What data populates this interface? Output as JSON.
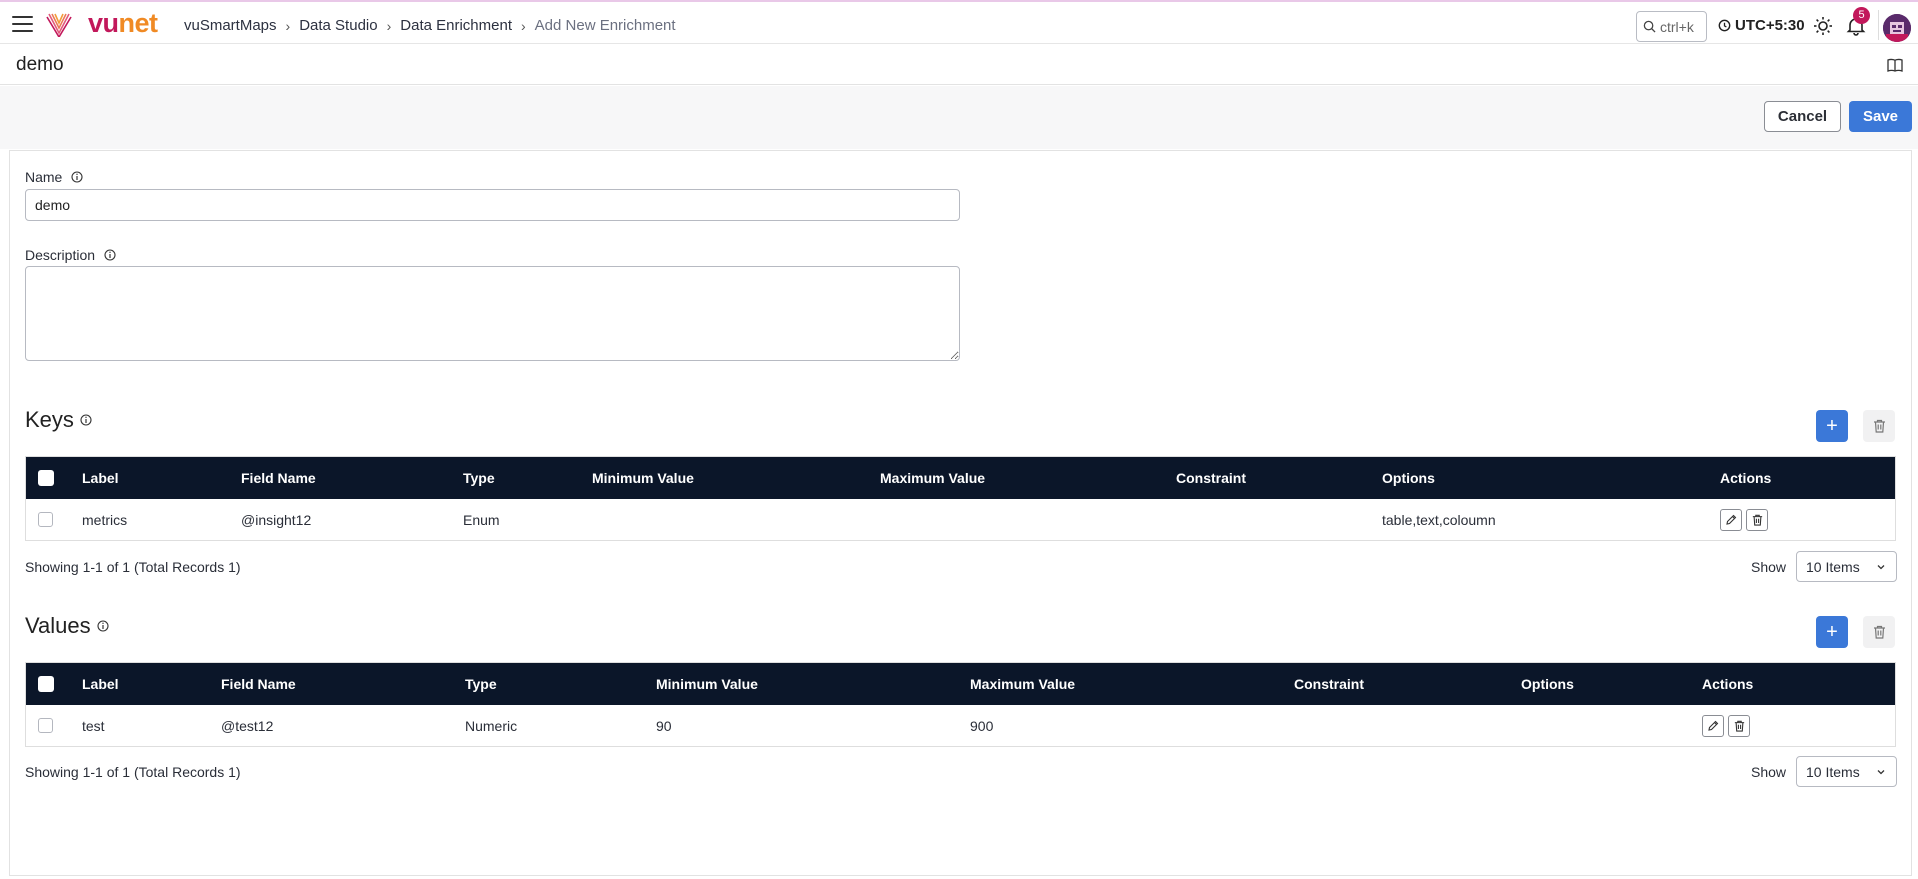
{
  "header": {
    "logo": {
      "v": "vu",
      "n": "net"
    },
    "breadcrumb": [
      "vuSmartMaps",
      "Data Studio",
      "Data Enrichment",
      "Add New Enrichment"
    ],
    "search_hint": "ctrl+k",
    "timezone": "UTC+5:30",
    "notification_count": "5"
  },
  "page": {
    "title": "demo",
    "cancel_label": "Cancel",
    "save_label": "Save"
  },
  "form": {
    "name_label": "Name",
    "name_value": "demo",
    "description_label": "Description",
    "description_value": ""
  },
  "keys": {
    "title": "Keys",
    "columns": [
      "Label",
      "Field Name",
      "Type",
      "Minimum Value",
      "Maximum Value",
      "Constraint",
      "Options",
      "Actions"
    ],
    "rows": [
      {
        "label": "metrics",
        "field_name": "@insight12",
        "type": "Enum",
        "min": "",
        "max": "",
        "constraint": "",
        "options": "table,text,coloumn"
      }
    ],
    "showing": "Showing 1-1 of 1 (Total Records 1)",
    "show_label": "Show",
    "page_size": "10 Items"
  },
  "values": {
    "title": "Values",
    "columns": [
      "Label",
      "Field Name",
      "Type",
      "Minimum Value",
      "Maximum Value",
      "Constraint",
      "Options",
      "Actions"
    ],
    "rows": [
      {
        "label": "test",
        "field_name": "@test12",
        "type": "Numeric",
        "min": "90",
        "max": "900",
        "constraint": "",
        "options": ""
      }
    ],
    "showing": "Showing 1-1 of 1 (Total Records 1)",
    "show_label": "Show",
    "page_size": "10 Items"
  },
  "colors": {
    "accent": "#3b78d8",
    "table_header": "#0b1629",
    "brand_magenta": "#c2185b",
    "brand_orange": "#f08a24"
  }
}
